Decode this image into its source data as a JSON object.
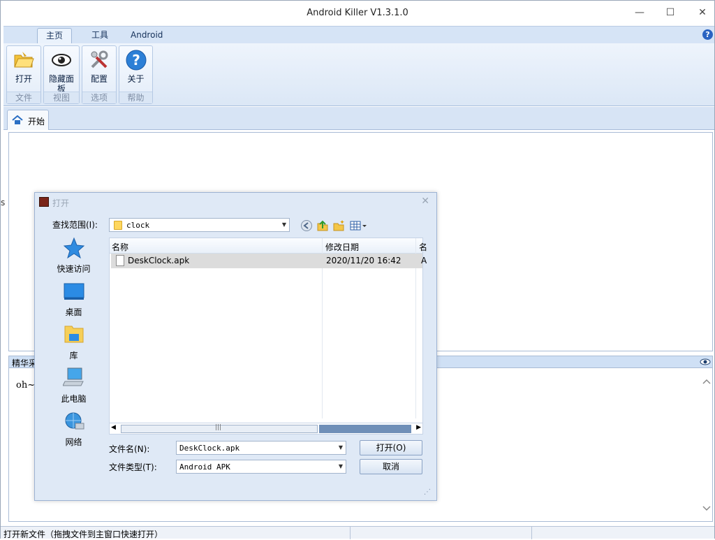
{
  "window": {
    "title": "Android Killer V1.3.1.0",
    "minimize": "—",
    "maximize": "☐",
    "close": "✕"
  },
  "ribbon": {
    "tabs": [
      {
        "label": "主页"
      },
      {
        "label": "工具"
      },
      {
        "label": "Android"
      }
    ],
    "help": "?",
    "groups": [
      {
        "button": "打开",
        "name": "文件",
        "icon": "folder-open-icon"
      },
      {
        "button": "隐藏面板",
        "name": "视图",
        "icon": "eye-icon"
      },
      {
        "button": "配置",
        "name": "选项",
        "icon": "tools-icon"
      },
      {
        "button": "关于",
        "name": "帮助",
        "icon": "help-icon"
      }
    ]
  },
  "doc_tabs": [
    {
      "label": "开始",
      "icon": "home-icon"
    }
  ],
  "bottom_panel": {
    "title": "精华采",
    "text": "oh~"
  },
  "left_edge_text": "s",
  "status": {
    "text": "打开新文件（拖拽文件到主窗口快速打开）"
  },
  "dialog": {
    "title": "打开",
    "close": "✕",
    "look_in_label": "查找范围(I):",
    "look_in_value": "clock",
    "places": [
      {
        "label": "快速访问",
        "icon": "star-icon"
      },
      {
        "label": "桌面",
        "icon": "desktop-icon"
      },
      {
        "label": "库",
        "icon": "library-icon"
      },
      {
        "label": "此电脑",
        "icon": "computer-icon"
      },
      {
        "label": "网络",
        "icon": "network-icon"
      }
    ],
    "columns": [
      "名称",
      "修改日期",
      "名"
    ],
    "files": [
      {
        "name": "DeskClock.apk",
        "date": "2020/11/20 16:42",
        "more": "A"
      }
    ],
    "filename_label": "文件名(N):",
    "filename_value": "DeskClock.apk",
    "filetype_label": "文件类型(T):",
    "filetype_value": "Android APK",
    "open_button": "打开(O)",
    "cancel_button": "取消",
    "scroll_grip": "|||"
  }
}
